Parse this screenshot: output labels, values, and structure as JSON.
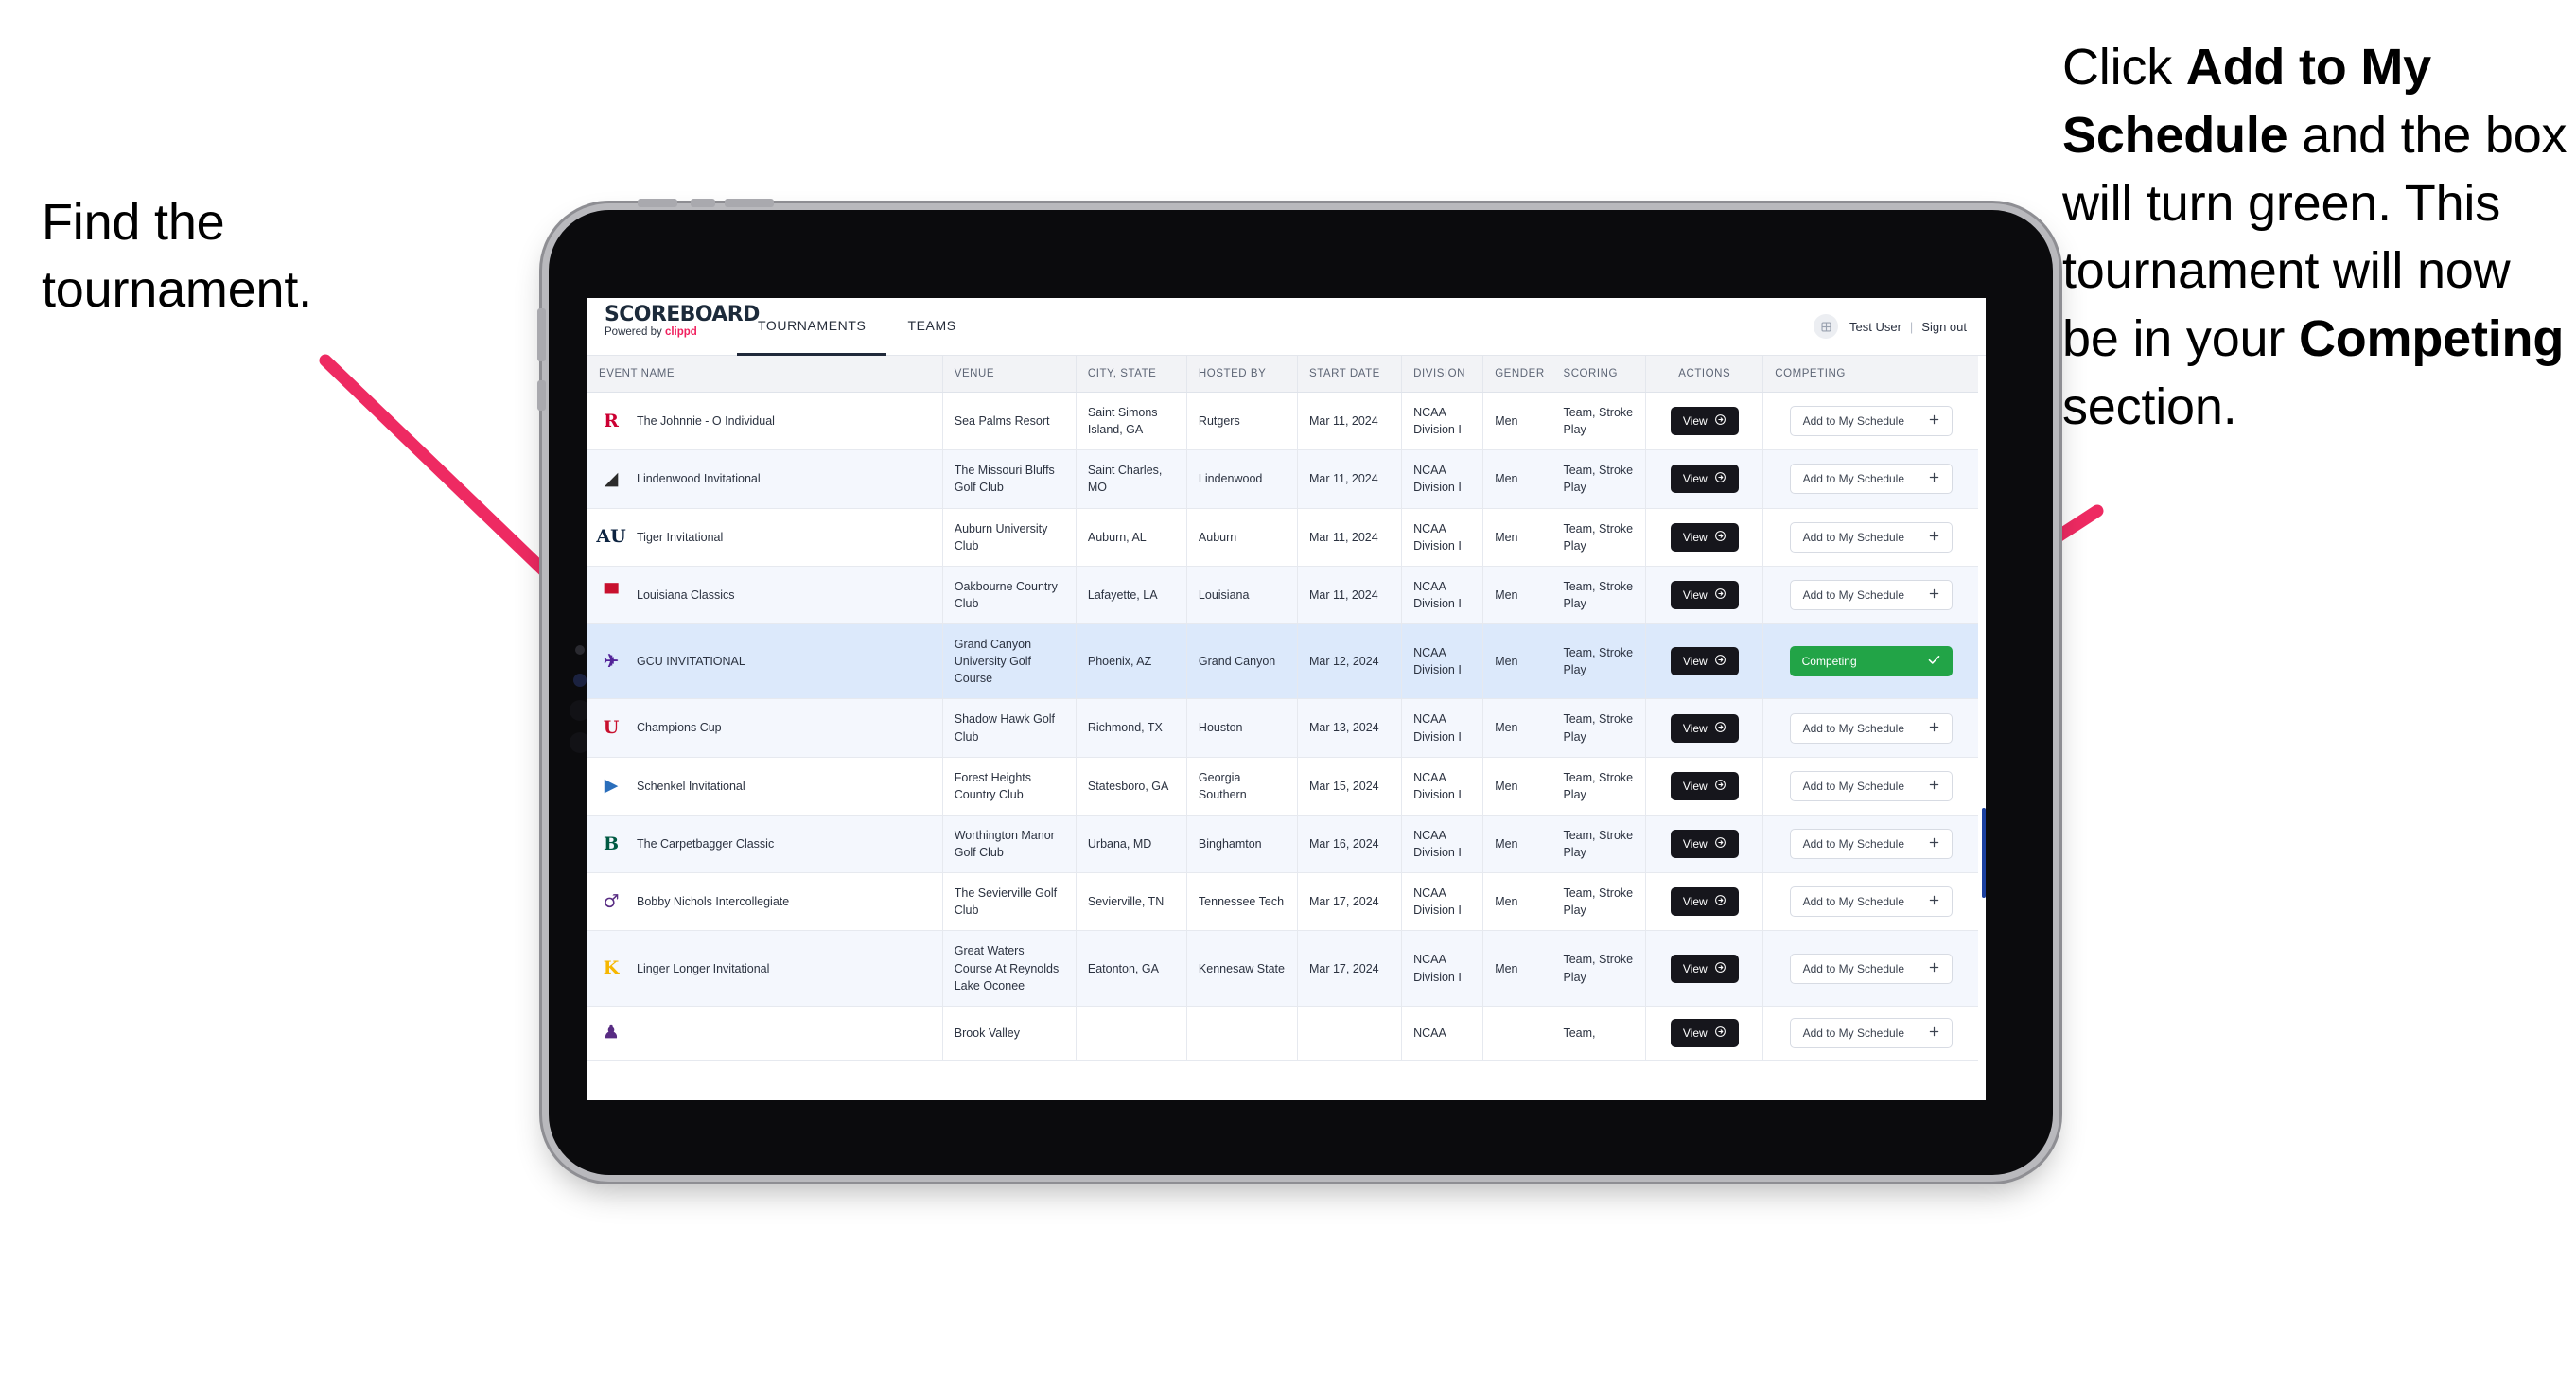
{
  "annotations": {
    "left": "Find the tournament.",
    "right_parts": [
      {
        "text": "Click ",
        "bold": false
      },
      {
        "text": "Add to My Schedule",
        "bold": true
      },
      {
        "text": " and the box will turn green. This tournament will now be in your ",
        "bold": false
      },
      {
        "text": "Competing",
        "bold": true
      },
      {
        "text": " section.",
        "bold": false
      }
    ],
    "arrow_color": "#ee2a62"
  },
  "app": {
    "brand": {
      "title": "SCOREBOARD",
      "powered_prefix": "Powered by ",
      "powered_brand": "clippd",
      "brand_accent": "#f0205e"
    },
    "nav": [
      {
        "label": "TOURNAMENTS",
        "active": true
      },
      {
        "label": "TEAMS",
        "active": false
      }
    ],
    "account": {
      "avatar_icon": "user-avatar-icon",
      "user": "Test User",
      "separator": "|",
      "signout": "Sign out"
    }
  },
  "table": {
    "columns": [
      {
        "key": "event",
        "label": "EVENT NAME"
      },
      {
        "key": "venue",
        "label": "VENUE"
      },
      {
        "key": "city",
        "label": "CITY, STATE"
      },
      {
        "key": "host",
        "label": "HOSTED BY"
      },
      {
        "key": "start",
        "label": "START DATE"
      },
      {
        "key": "division",
        "label": "DIVISION"
      },
      {
        "key": "gender",
        "label": "GENDER"
      },
      {
        "key": "scoring",
        "label": "SCORING"
      },
      {
        "key": "actions",
        "label": "ACTIONS"
      },
      {
        "key": "competing",
        "label": "COMPETING"
      }
    ],
    "buttons": {
      "view": "View",
      "view_icon": "arrow-circle-right-icon",
      "add": "Add to My Schedule",
      "add_icon": "plus-icon",
      "competing": "Competing",
      "competing_icon": "check-icon",
      "competing_color": "#22a447"
    },
    "rows": [
      {
        "logo": {
          "glyph": "R",
          "color": "#cc0033",
          "name": "rutgers-logo"
        },
        "event": "The Johnnie - O Individual",
        "venue": "Sea Palms Resort",
        "city": "Saint Simons Island, GA",
        "host": "Rutgers",
        "start": "Mar 11, 2024",
        "division": "NCAA Division I",
        "gender": "Men",
        "scoring": "Team, Stroke Play",
        "competing": false,
        "selected": false
      },
      {
        "logo": {
          "glyph": "◢",
          "color": "#2b2b2b",
          "name": "lindenwood-lion-logo"
        },
        "event": "Lindenwood Invitational",
        "venue": "The Missouri Bluffs Golf Club",
        "city": "Saint Charles, MO",
        "host": "Lindenwood",
        "start": "Mar 11, 2024",
        "division": "NCAA Division I",
        "gender": "Men",
        "scoring": "Team, Stroke Play",
        "competing": false,
        "selected": false
      },
      {
        "logo": {
          "glyph": "AU",
          "color": "#0c2340",
          "name": "auburn-logo"
        },
        "event": "Tiger Invitational",
        "venue": "Auburn University Club",
        "city": "Auburn, AL",
        "host": "Auburn",
        "start": "Mar 11, 2024",
        "division": "NCAA Division I",
        "gender": "Men",
        "scoring": "Team, Stroke Play",
        "competing": false,
        "selected": false
      },
      {
        "logo": {
          "glyph": "▀",
          "color": "#c8102e",
          "name": "louisiana-ragin-cajuns-logo"
        },
        "event": "Louisiana Classics",
        "venue": "Oakbourne Country Club",
        "city": "Lafayette, LA",
        "host": "Louisiana",
        "start": "Mar 11, 2024",
        "division": "NCAA Division I",
        "gender": "Men",
        "scoring": "Team, Stroke Play",
        "competing": false,
        "selected": false
      },
      {
        "logo": {
          "glyph": "✈",
          "color": "#522398",
          "name": "grand-canyon-lopes-logo"
        },
        "event": "GCU INVITATIONAL",
        "venue": "Grand Canyon University Golf Course",
        "city": "Phoenix, AZ",
        "host": "Grand Canyon",
        "start": "Mar 12, 2024",
        "division": "NCAA Division I",
        "gender": "Men",
        "scoring": "Team, Stroke Play",
        "competing": true,
        "selected": true
      },
      {
        "logo": {
          "glyph": "U",
          "color": "#c8102e",
          "name": "houston-cougars-logo"
        },
        "event": "Champions Cup",
        "venue": "Shadow Hawk Golf Club",
        "city": "Richmond, TX",
        "host": "Houston",
        "start": "Mar 13, 2024",
        "division": "NCAA Division I",
        "gender": "Men",
        "scoring": "Team, Stroke Play",
        "competing": false,
        "selected": false
      },
      {
        "logo": {
          "glyph": "▶",
          "color": "#2a6ebb",
          "name": "georgia-southern-eagles-logo"
        },
        "event": "Schenkel Invitational",
        "venue": "Forest Heights Country Club",
        "city": "Statesboro, GA",
        "host": "Georgia Southern",
        "start": "Mar 15, 2024",
        "division": "NCAA Division I",
        "gender": "Men",
        "scoring": "Team, Stroke Play",
        "competing": false,
        "selected": false
      },
      {
        "logo": {
          "glyph": "B",
          "color": "#005a43",
          "name": "binghamton-bearcats-logo"
        },
        "event": "The Carpetbagger Classic",
        "venue": "Worthington Manor Golf Club",
        "city": "Urbana, MD",
        "host": "Binghamton",
        "start": "Mar 16, 2024",
        "division": "NCAA Division I",
        "gender": "Men",
        "scoring": "Team, Stroke Play",
        "competing": false,
        "selected": false
      },
      {
        "logo": {
          "glyph": "♂",
          "color": "#582c83",
          "name": "tennessee-tech-eagle-logo"
        },
        "event": "Bobby Nichols Intercollegiate",
        "venue": "The Sevierville Golf Club",
        "city": "Sevierville, TN",
        "host": "Tennessee Tech",
        "start": "Mar 17, 2024",
        "division": "NCAA Division I",
        "gender": "Men",
        "scoring": "Team, Stroke Play",
        "competing": false,
        "selected": false
      },
      {
        "logo": {
          "glyph": "K",
          "color": "#f6b700",
          "name": "kennesaw-state-owls-logo"
        },
        "event": "Linger Longer Invitational",
        "venue": "Great Waters Course At Reynolds Lake Oconee",
        "city": "Eatonton, GA",
        "host": "Kennesaw State",
        "start": "Mar 17, 2024",
        "division": "NCAA Division I",
        "gender": "Men",
        "scoring": "Team, Stroke Play",
        "competing": false,
        "selected": false
      },
      {
        "logo": {
          "glyph": "♟",
          "color": "#582c83",
          "name": "east-carolina-pirates-logo"
        },
        "event": "",
        "venue": "Brook Valley",
        "city": "",
        "host": "",
        "start": "",
        "division": "NCAA",
        "gender": "",
        "scoring": "Team,",
        "competing": false,
        "selected": false
      }
    ]
  }
}
